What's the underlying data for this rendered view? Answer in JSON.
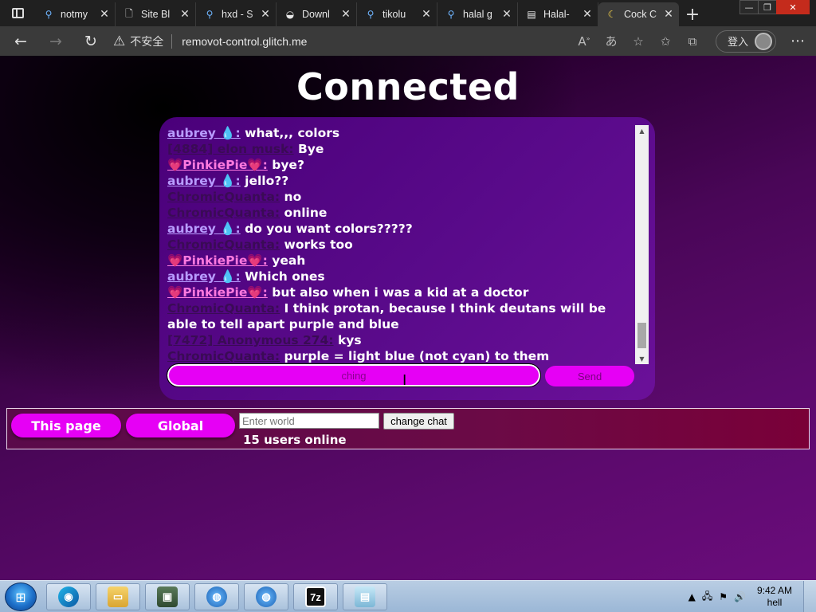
{
  "browser": {
    "tabs": [
      {
        "title": "notmy",
        "icon": "search-icon"
      },
      {
        "title": "Site Bl",
        "icon": "document-icon"
      },
      {
        "title": "hxd - S",
        "icon": "search-icon"
      },
      {
        "title": "Downl",
        "icon": "download-site-icon"
      },
      {
        "title": "tikolu",
        "icon": "search-icon"
      },
      {
        "title": "halal g",
        "icon": "search-icon"
      },
      {
        "title": "Halal-",
        "icon": "book-icon"
      },
      {
        "title": "Cock C",
        "icon": "moon-icon"
      }
    ],
    "security_label": "不安全",
    "url": "removot-control.glitch.me",
    "login_label": "登入"
  },
  "page": {
    "title": "Connected",
    "messages": [
      {
        "name": "aubrey 💧:",
        "style": "aubrey",
        "text": "what,,, colors"
      },
      {
        "name": "[4884] elon musk:",
        "style": "dark",
        "text": "Bye"
      },
      {
        "name": "💗PinkiePie💗:",
        "style": "pinkie",
        "text": "bye?"
      },
      {
        "name": "aubrey 💧:",
        "style": "aubrey",
        "text": "jello??"
      },
      {
        "name": "ChromicQuanta:",
        "style": "dark",
        "text": "no"
      },
      {
        "name": "ChromicQuanta:",
        "style": "dark",
        "text": "online"
      },
      {
        "name": "aubrey 💧:",
        "style": "aubrey",
        "text": "do you want colors?????"
      },
      {
        "name": "ChromicQuanta:",
        "style": "dark",
        "text": "works too"
      },
      {
        "name": "💗PinkiePie💗:",
        "style": "pinkie",
        "text": "yeah"
      },
      {
        "name": "aubrey 💧:",
        "style": "aubrey",
        "text": "Which ones"
      },
      {
        "name": "💗PinkiePie💗:",
        "style": "pinkie",
        "text": "but also when i was a kid at a doctor"
      },
      {
        "name": "ChromicQuanta:",
        "style": "dark",
        "text": "I think protan, because I think deutans will be able to tell apart purple and blue"
      },
      {
        "name": "[7472] Anonymous 274:",
        "style": "dark",
        "text": "kys"
      },
      {
        "name": "ChromicQuanta:",
        "style": "dark",
        "text": "purple = light blue (not cyan) to them"
      }
    ],
    "chat_input_value": "ching",
    "send_label": "Send",
    "this_page_label": "This page",
    "global_label": "Global",
    "world_placeholder": "Enter world",
    "change_chat_label": "change chat",
    "users_online": "15 users online"
  },
  "taskbar": {
    "apps": [
      {
        "name": "edge",
        "icon": "edge-icon"
      },
      {
        "name": "explorer",
        "icon": "folder-icon"
      },
      {
        "name": "computer",
        "icon": "monitor-icon"
      },
      {
        "name": "network",
        "icon": "globe-icon"
      },
      {
        "name": "browser",
        "icon": "globe-icon"
      },
      {
        "name": "7zip",
        "icon": "7z-icon",
        "label": "7z"
      },
      {
        "name": "notepad",
        "icon": "notepad-icon"
      }
    ],
    "time": "9:42 AM",
    "subtitle": "hell"
  },
  "colors": {
    "accent": "#e600f5",
    "aubrey": "#b89cff",
    "pinkie": "#ff7adf"
  }
}
